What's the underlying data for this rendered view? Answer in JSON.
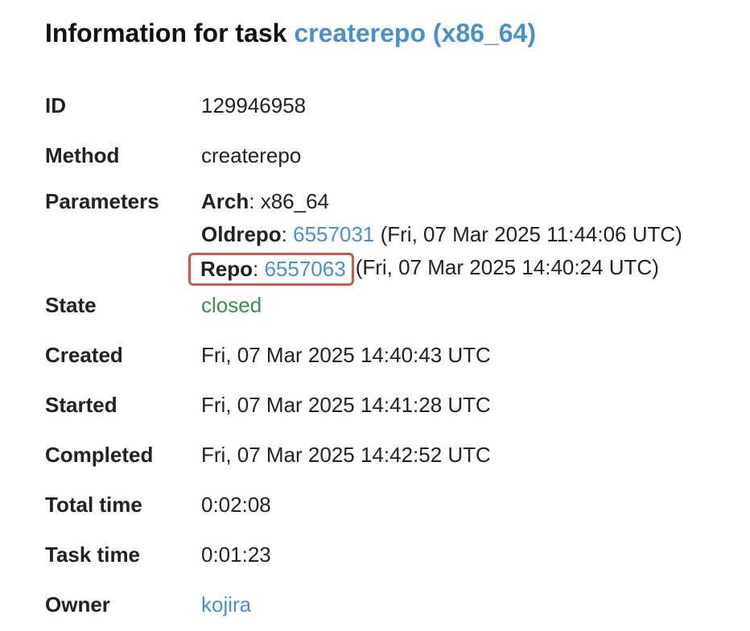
{
  "page": {
    "title_prefix": "Information for task",
    "title_link": "createrepo (x86_64)"
  },
  "fields": {
    "id": {
      "label": "ID",
      "value": "129946958"
    },
    "method": {
      "label": "Method",
      "value": "createrepo"
    },
    "parameters": {
      "label": "Parameters",
      "arch": {
        "key": "Arch",
        "separator": ":",
        "value": "x86_64"
      },
      "oldrepo": {
        "key": "Oldrepo",
        "separator": ":",
        "link": "6557031",
        "suffix": "(Fri, 07 Mar 2025 11:44:06 UTC)"
      },
      "repo": {
        "key": "Repo",
        "separator": ":",
        "link": "6557063",
        "suffix": "(Fri, 07 Mar 2025 14:40:24 UTC)"
      }
    },
    "state": {
      "label": "State",
      "value": "closed",
      "color": "#3f8c4e"
    },
    "created": {
      "label": "Created",
      "value": "Fri, 07 Mar 2025 14:40:43 UTC"
    },
    "started": {
      "label": "Started",
      "value": "Fri, 07 Mar 2025 14:41:28 UTC"
    },
    "completed": {
      "label": "Completed",
      "value": "Fri, 07 Mar 2025 14:42:52 UTC"
    },
    "total_time": {
      "label": "Total time",
      "value": "0:02:08"
    },
    "task_time": {
      "label": "Task time",
      "value": "0:01:23"
    },
    "owner": {
      "label": "Owner",
      "value": "kojira"
    }
  },
  "colors": {
    "link": "#4a8fd0",
    "highlight_border": "#d9534f",
    "text": "#222222"
  }
}
